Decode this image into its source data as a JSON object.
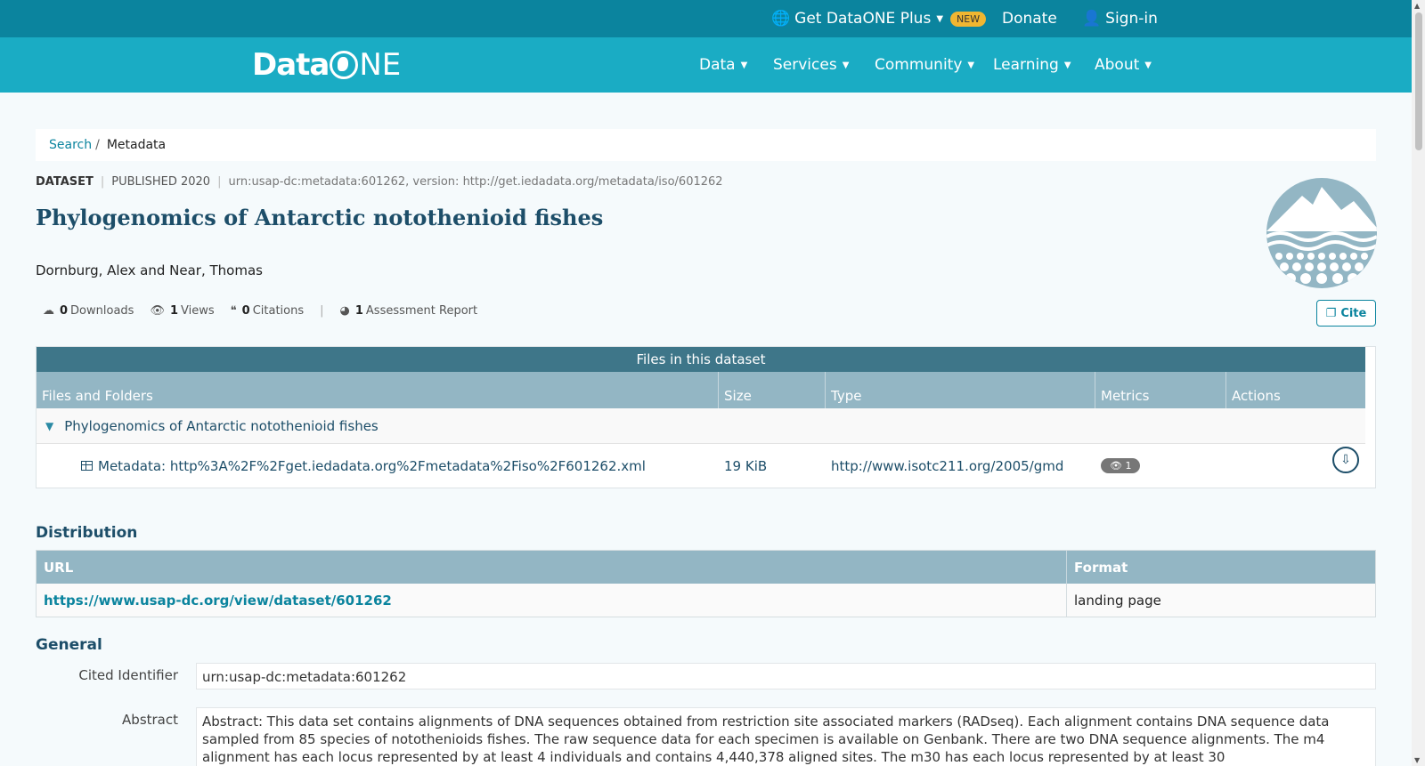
{
  "topbar": {
    "plus_label": "Get DataONE Plus",
    "new_badge": "NEW",
    "donate": "Donate",
    "signin": "Sign-in"
  },
  "logo": {
    "prefix": "Data",
    "suffix": "NE"
  },
  "nav": {
    "items": [
      {
        "label": "Data"
      },
      {
        "label": "Services"
      },
      {
        "label": "Community"
      },
      {
        "label": "Learning"
      },
      {
        "label": "About"
      }
    ]
  },
  "breadcrumb": {
    "search": "Search",
    "sep": "/",
    "current": "Metadata"
  },
  "dataset": {
    "type": "DATASET",
    "published": "PUBLISHED 2020",
    "urn": "urn:usap-dc:metadata:601262, version: http://get.iedadata.org/metadata/iso/601262",
    "title": "Phylogenomics of Antarctic notothenioid fishes",
    "authors": "Dornburg, Alex and Near, Thomas"
  },
  "metrics": {
    "downloads_count": "0",
    "downloads_label": "Downloads",
    "views_count": "1",
    "views_label": "Views",
    "citations_count": "0",
    "citations_label": "Citations",
    "assessment_count": "1",
    "assessment_label": "Assessment Report"
  },
  "cite_label": "Cite",
  "files": {
    "heading": "Files in this dataset",
    "columns": [
      "Files and Folders",
      "Size",
      "Type",
      "Metrics",
      "Actions"
    ],
    "folder_name": "Phylogenomics of Antarctic notothenioid fishes",
    "file": {
      "name": "Metadata: http%3A%2F%2Fget.iedadata.org%2Fmetadata%2Fiso%2F601262.xml",
      "size": "19 KiB",
      "type": "http://www.isotc211.org/2005/gmd",
      "views": "1"
    }
  },
  "distribution": {
    "heading": "Distribution",
    "col_url": "URL",
    "col_format": "Format",
    "url": "https://www.usap-dc.org/view/dataset/601262",
    "format": "landing page"
  },
  "general": {
    "heading": "General",
    "cited_identifier_label": "Cited Identifier",
    "cited_identifier": "urn:usap-dc:metadata:601262",
    "abstract_label": "Abstract",
    "abstract": "Abstract: This data set contains alignments of DNA sequences obtained from restriction site associated markers (RADseq). Each alignment contains DNA sequence data sampled from 85 species of notothenioids fishes. The raw sequence data for each specimen is available on Genbank. There are two DNA sequence alignments. The m4 alignment has each locus represented by at least 4 individuals and contains 4,440,378 aligned sites. The m30 has each locus represented by at least 30"
  },
  "colors": {
    "topbar": "#0b849e",
    "nav": "#1aacc4",
    "files_header": "#3e7689",
    "table_header": "#93b6c4",
    "title": "#1d4e69"
  }
}
